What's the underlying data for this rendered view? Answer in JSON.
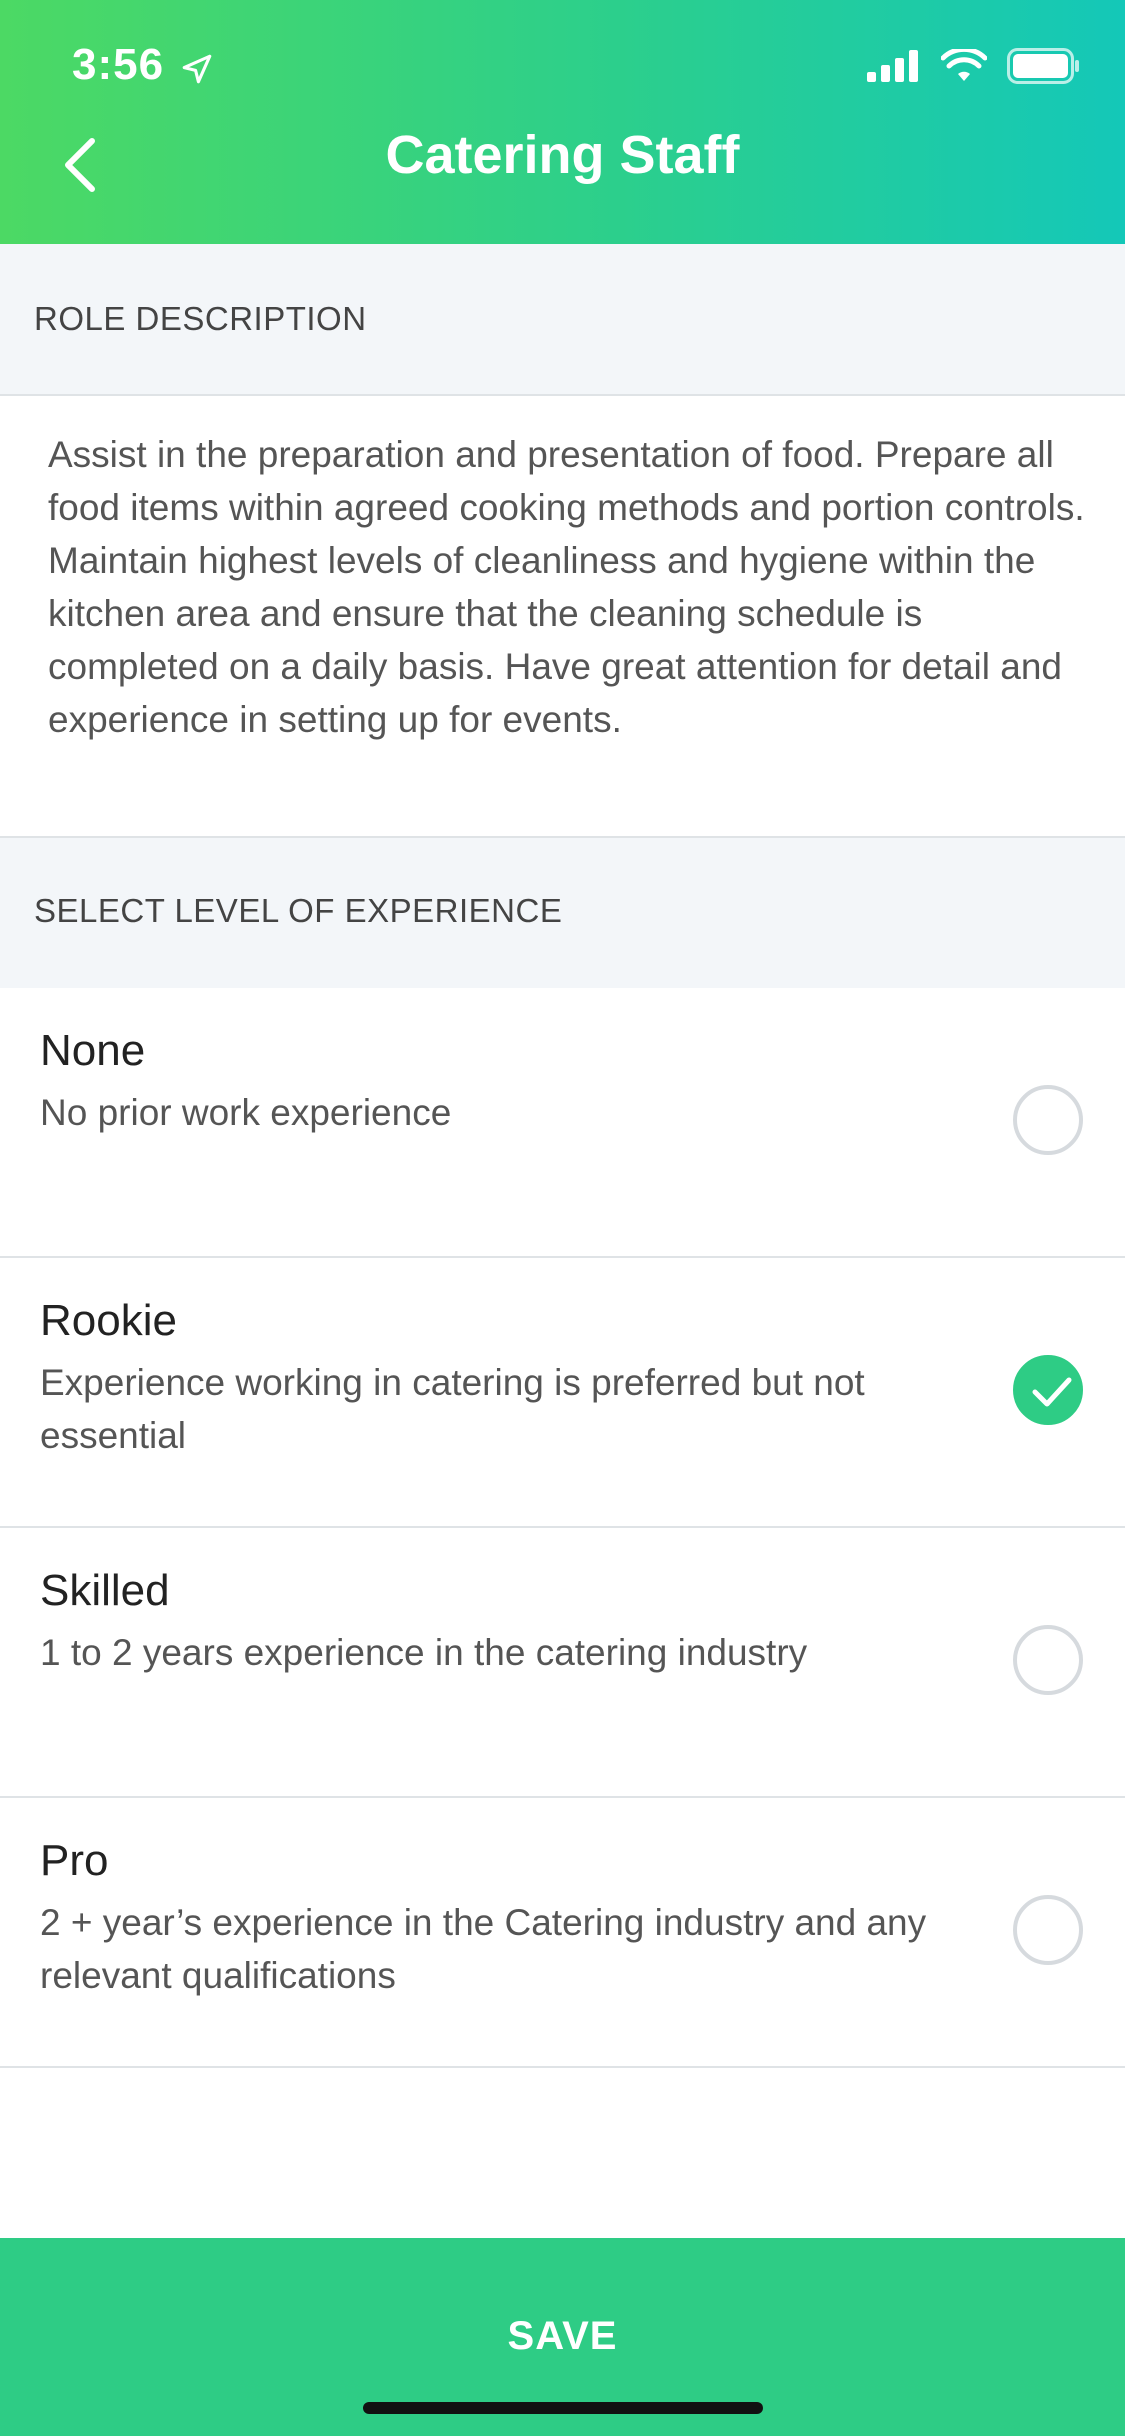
{
  "status_bar": {
    "time": "3:56",
    "icons": [
      "location-arrow-icon",
      "signal-icon",
      "wifi-icon",
      "battery-icon"
    ]
  },
  "header": {
    "back_icon": "chevron-left-icon",
    "title": "Catering Staff",
    "gradient_start": "#4cd964",
    "gradient_end": "#14c8b8"
  },
  "role_section": {
    "heading": "ROLE DESCRIPTION",
    "description": "Assist in the preparation and presentation of food. Prepare all food items within agreed cooking methods and portion controls. Maintain highest levels of cleanliness and hygiene within the kitchen area and ensure that the cleaning schedule is completed on a daily basis. Have great attention for detail and experience in setting up for events."
  },
  "experience_section": {
    "heading": "SELECT LEVEL OF EXPERIENCE",
    "options": [
      {
        "name": "None",
        "description": "No prior work experience",
        "selected": false
      },
      {
        "name": "Rookie",
        "description": "Experience working in catering is preferred but not essential",
        "selected": true
      },
      {
        "name": "Skilled",
        "description": "1 to 2 years experience in the catering industry",
        "selected": false
      },
      {
        "name": "Pro",
        "description": "2 + year’s experience in the Catering industry and any relevant qualifications",
        "selected": false
      }
    ]
  },
  "footer": {
    "save_label": "SAVE",
    "accent": "#2ecc85"
  }
}
